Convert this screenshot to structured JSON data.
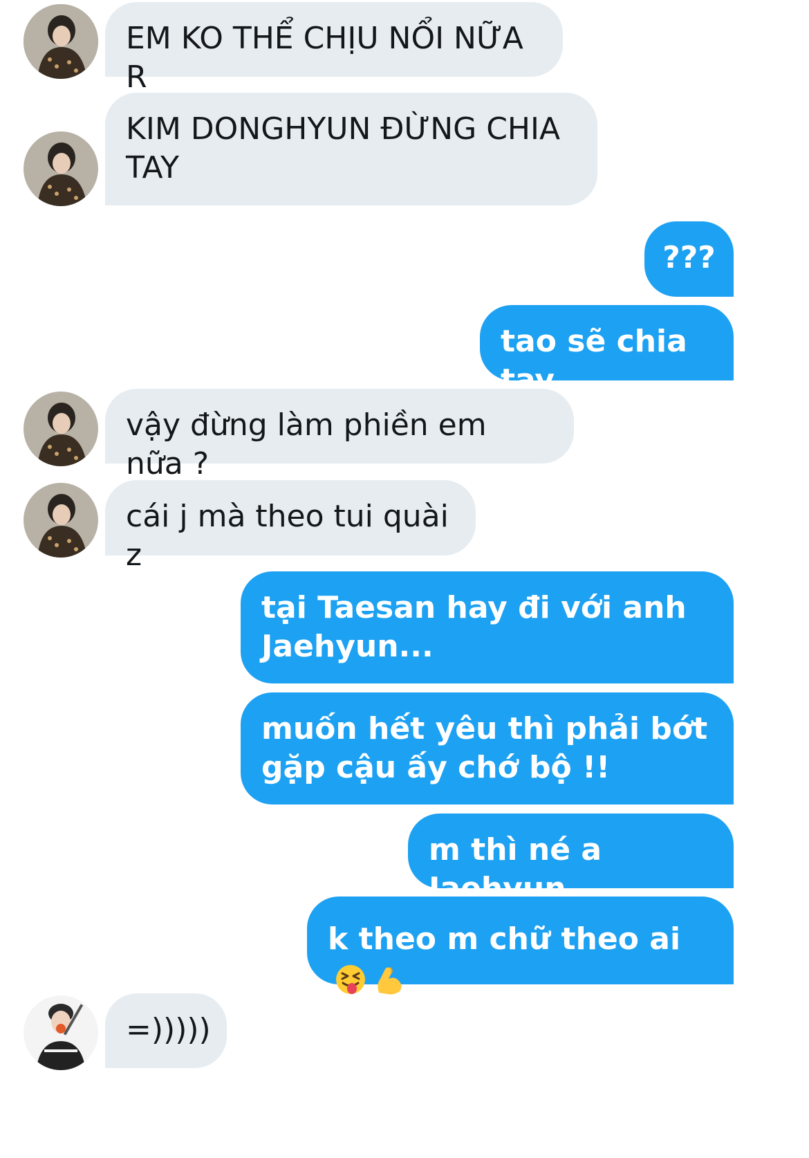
{
  "conversation": {
    "messages": [
      {
        "sender": "them",
        "text": "EM KO THỂ CHỊU NỔI NỮA R"
      },
      {
        "sender": "them",
        "text": "KIM DONGHYUN ĐỪNG CHIA TAY"
      },
      {
        "sender": "me",
        "text": "???"
      },
      {
        "sender": "me",
        "text": "tao sẽ chia tay"
      },
      {
        "sender": "them",
        "text": "vậy đừng làm phiền em nữa ?"
      },
      {
        "sender": "them",
        "text": "cái j mà theo tui quài z"
      },
      {
        "sender": "me",
        "text": "tại Taesan hay đi với anh Jaehyun..."
      },
      {
        "sender": "me",
        "text": "muốn hết yêu thì phải bớt gặp cậu ấy chớ bộ !!"
      },
      {
        "sender": "me",
        "text": "m thì né a Jaehyun"
      },
      {
        "sender": "me",
        "text": "k theo m chữ theo ai",
        "emojis": [
          "squinting-face-with-tongue-icon",
          "flexed-biceps-icon"
        ]
      },
      {
        "sender": "third",
        "text": "=)))))"
      }
    ]
  },
  "colors": {
    "incoming_bubble": "#e6ecf0",
    "outgoing_bubble": "#1da1f2",
    "incoming_text": "#14171a",
    "outgoing_text": "#ffffff"
  }
}
